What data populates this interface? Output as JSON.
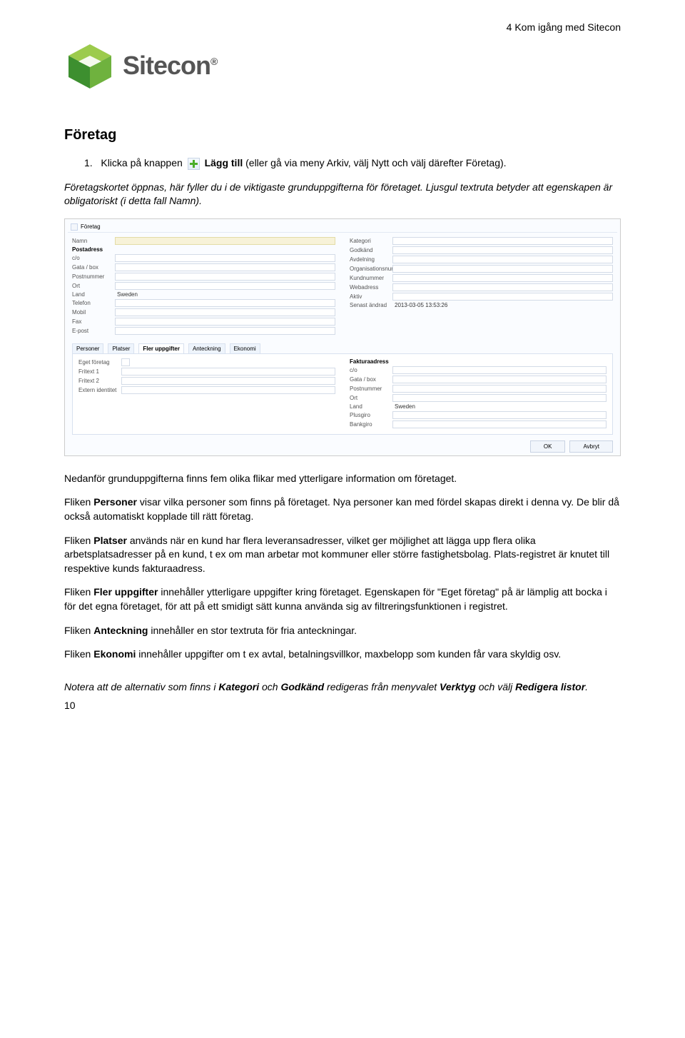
{
  "header": {
    "chapter": "4 Kom igång med Sitecon"
  },
  "logo": {
    "name": "Sitecon",
    "reg": "®"
  },
  "section": {
    "title": "Företag"
  },
  "step": {
    "num": "1.",
    "prefix": "Klicka på knappen",
    "bold1": "Lägg till",
    "suffix": "(eller gå via meny Arkiv, välj Nytt och välj därefter Företag)."
  },
  "para1": "Företagskortet öppnas, här fyller du i de viktigaste grunduppgifterna för företaget. Ljusgul textruta betyder att egenskapen är obligatoriskt (i detta fall Namn).",
  "mock": {
    "title": "Företag",
    "left": {
      "Namn": "",
      "Postadress": "",
      "c/o": "",
      "Gata / box": "",
      "Postnummer": "",
      "Ort": "",
      "Land": "Sweden",
      "Telefon": "",
      "Mobil": "",
      "Fax": "",
      "E-post": ""
    },
    "right": {
      "Kategori": "",
      "Godkänd": "",
      "Avdelning": "",
      "Organisationsnummer": "",
      "Kundnummer": "",
      "Webadress": "",
      "Aktiv": "",
      "Senast ändrad": "2013-03-05 13:53:26"
    },
    "tabs": [
      "Personer",
      "Platser",
      "Fler uppgifter",
      "Anteckning",
      "Ekonomi"
    ],
    "activeTab": "Fler uppgifter",
    "lowerLeft": {
      "Eget företag": "",
      "Fritext 1": "",
      "Fritext 2": "",
      "Extern identitet": ""
    },
    "lowerRightTitle": "Fakturaadress",
    "lowerRight": {
      "c/o": "",
      "Gata / box": "",
      "Postnummer": "",
      "Ort": "",
      "Land": "Sweden",
      "Plusgiro": "",
      "Bankgiro": ""
    },
    "buttons": {
      "ok": "OK",
      "cancel": "Avbryt"
    }
  },
  "para2": "Nedanför grunduppgifterna finns fem olika flikar med ytterligare information om företaget.",
  "para3": {
    "lead": "Fliken ",
    "b": "Personer",
    "rest": " visar vilka personer som finns på företaget. Nya personer kan med fördel skapas direkt i denna vy. De blir då också automatiskt kopplade till rätt företag."
  },
  "para4": {
    "lead": "Fliken ",
    "b": "Platser",
    "rest": " används när en kund har flera leveransadresser, vilket ger möjlighet att lägga upp flera olika arbetsplatsadresser på en kund, t ex om man arbetar mot kommuner eller större fastighetsbolag. Plats-registret är knutet till respektive kunds fakturaadress."
  },
  "para5": {
    "lead": "Fliken ",
    "b": "Fler uppgifter",
    "rest": " innehåller ytterligare uppgifter kring företaget. Egenskapen för \"Eget företag\" på är lämplig att bocka i för det egna företaget, för att på ett smidigt sätt kunna använda sig av filtreringsfunktionen i registret."
  },
  "para6": {
    "lead": "Fliken ",
    "b": "Anteckning",
    "rest": " innehåller en stor textruta för fria anteckningar."
  },
  "para7": {
    "lead": "Fliken ",
    "b": "Ekonomi",
    "rest": " innehåller uppgifter om t ex avtal, betalningsvillkor, maxbelopp som kunden får vara skyldig osv."
  },
  "note": {
    "lead": "Notera att de alternativ som finns i ",
    "b1": "Kategori",
    "mid": " och ",
    "b2": "Godkänd",
    "rest1": " redigeras från menyvalet ",
    "b3": "Verktyg",
    "rest2": " och välj ",
    "b4": "Redigera listor",
    "end": "."
  },
  "pageNum": "10"
}
